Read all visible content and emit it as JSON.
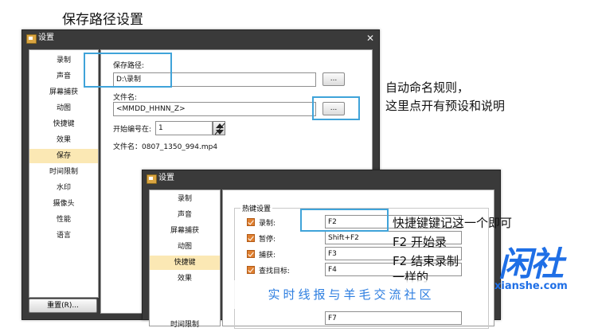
{
  "caption": "保存路径设置",
  "window1": {
    "title": "设置",
    "close_icon": "close-icon",
    "nav_items": [
      {
        "label": "录制"
      },
      {
        "label": "声音"
      },
      {
        "label": "屏幕捕获"
      },
      {
        "label": "动图"
      },
      {
        "label": "快捷键"
      },
      {
        "label": "效果"
      },
      {
        "label": "保存",
        "active": true
      },
      {
        "label": "时间限制"
      },
      {
        "label": "水印"
      },
      {
        "label": "摄像头"
      },
      {
        "label": "性能"
      },
      {
        "label": "语言"
      }
    ],
    "save_path_label": "保存路径:",
    "save_path_value": "D:\\录制",
    "browse_label": "...",
    "filename_label": "文件名:",
    "filename_value": "<MMDD_HHNN_Z>",
    "filename_btn_label": "...",
    "start_number_label": "开始编号在:",
    "start_number_value": "1",
    "filename_preview": "文件名：0807_1350_994.mp4",
    "reset_label": "重置(R)..."
  },
  "annotation_right": [
    "自动命名规则，",
    "这里点开有预设和说明"
  ],
  "window2": {
    "title": "设置",
    "nav_items": [
      {
        "label": "录制"
      },
      {
        "label": "声音"
      },
      {
        "label": "屏幕捕获"
      },
      {
        "label": "动图"
      },
      {
        "label": "快捷键",
        "active": true
      },
      {
        "label": "效果"
      },
      {
        "label": "时间限制"
      }
    ],
    "group_title": "热键设置",
    "hotkeys": [
      {
        "label": "录制:",
        "value": "F2"
      },
      {
        "label": "暂停:",
        "value": "Shift+F2"
      },
      {
        "label": "捕获:",
        "value": "F3"
      },
      {
        "label": "查找目标:",
        "value": "F4"
      },
      {
        "label": "",
        "value": "F7"
      }
    ]
  },
  "annotation_hotkeys": [
    "快捷键键记这一个即可",
    "F2 开始录",
    "F2 结束录制",
    "一样的"
  ],
  "banner_text": "实时线报与羊毛交流社区",
  "logo": {
    "main": "闲社",
    "sub": "xianshe.com"
  },
  "colors": {
    "highlight": "#3fa3d9",
    "active_nav": "#fbe8b4",
    "logo": "#1f6fe6",
    "banner_text": "#2d7ee0"
  }
}
